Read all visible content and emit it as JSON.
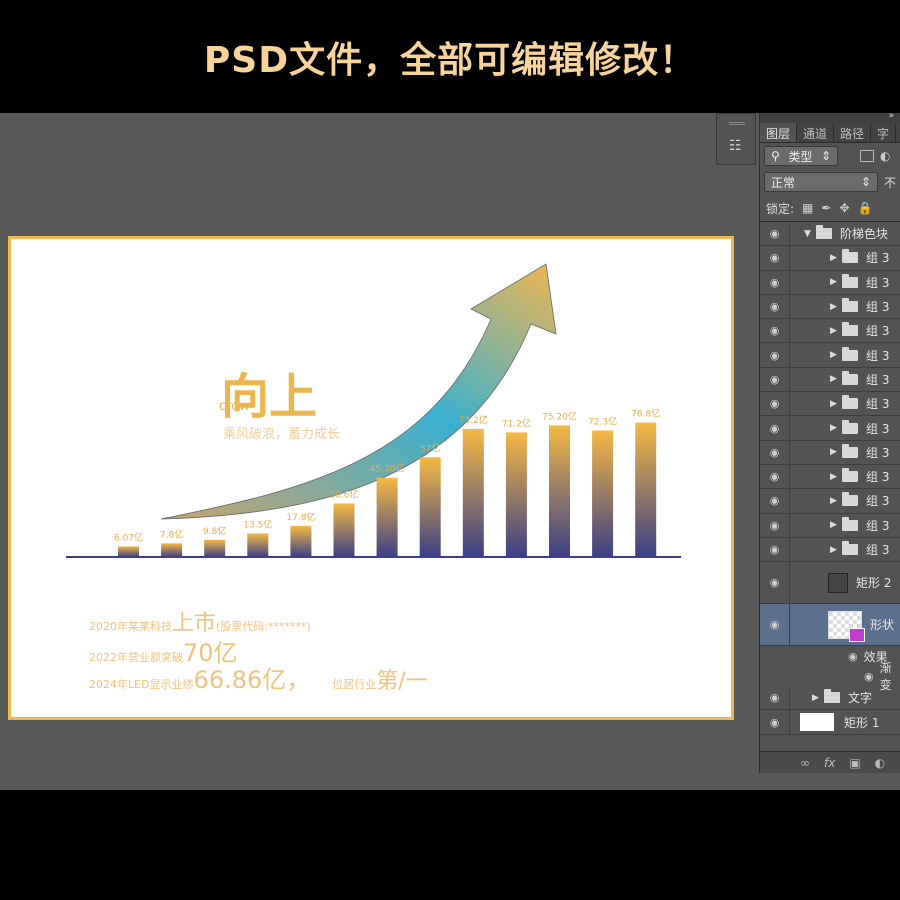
{
  "banner": {
    "text": "PSD文件，全部可编辑修改！"
  },
  "canvas": {
    "title": "向上",
    "title_en": "crow",
    "subtitle": "乘风破浪，蓄力成长",
    "info": [
      {
        "prefix": "2020年某某科技",
        "highlight": "上市",
        "suffix": "(股票代码:*******)"
      },
      {
        "prefix": "2022年营业额突破",
        "highlight": "70亿",
        "suffix": ""
      },
      {
        "prefix": "2024年LED显示业绩",
        "highlight": "66.86亿，",
        "mid": "位居行业",
        "highlight2": "第/一"
      }
    ]
  },
  "chart_data": {
    "type": "bar",
    "categories": [
      "",
      "",
      "",
      "",
      "",
      "",
      "",
      "",
      "",
      "",
      "",
      "",
      ""
    ],
    "labels": [
      "6.07亿",
      "7.8亿",
      "9.8亿",
      "13.5亿",
      "17.8亿",
      "30.6亿",
      "45.30亿",
      "57亿",
      "73.2亿",
      "71.2亿",
      "75.20亿",
      "72.3亿",
      "76.8亿"
    ],
    "values": [
      6.07,
      7.8,
      9.8,
      13.5,
      17.8,
      30.6,
      45.3,
      57,
      73.2,
      71.2,
      75.2,
      72.3,
      76.8
    ],
    "ylim": [
      0,
      80
    ],
    "grid": false,
    "colors": {
      "top": "#f5b944",
      "bottom": "#3b3f86",
      "axis": "#3b3f86",
      "label": "#e8ac49"
    }
  },
  "photoshop": {
    "tabs": [
      "图层",
      "通道",
      "路径",
      "字"
    ],
    "kind_filter": "类型",
    "blend_mode": "正常",
    "opacity_short": "不",
    "lock_label": "锁定:",
    "layers": {
      "group_root": "阶梯色块",
      "groups": [
        "组 3",
        "组 3",
        "组 3",
        "组 3",
        "组 3",
        "组 3",
        "组 3",
        "组 3",
        "组 3",
        "组 3",
        "组 3",
        "组 3",
        "组 3"
      ],
      "rect2": "矩形 2",
      "shape": "形状",
      "effects": "效果",
      "gradient": "渐变",
      "text_group": "文字",
      "rect1": "矩形 1"
    },
    "bottom_icons": [
      "link-icon",
      "fx-icon",
      "mask-icon",
      "adjustment-icon"
    ]
  }
}
